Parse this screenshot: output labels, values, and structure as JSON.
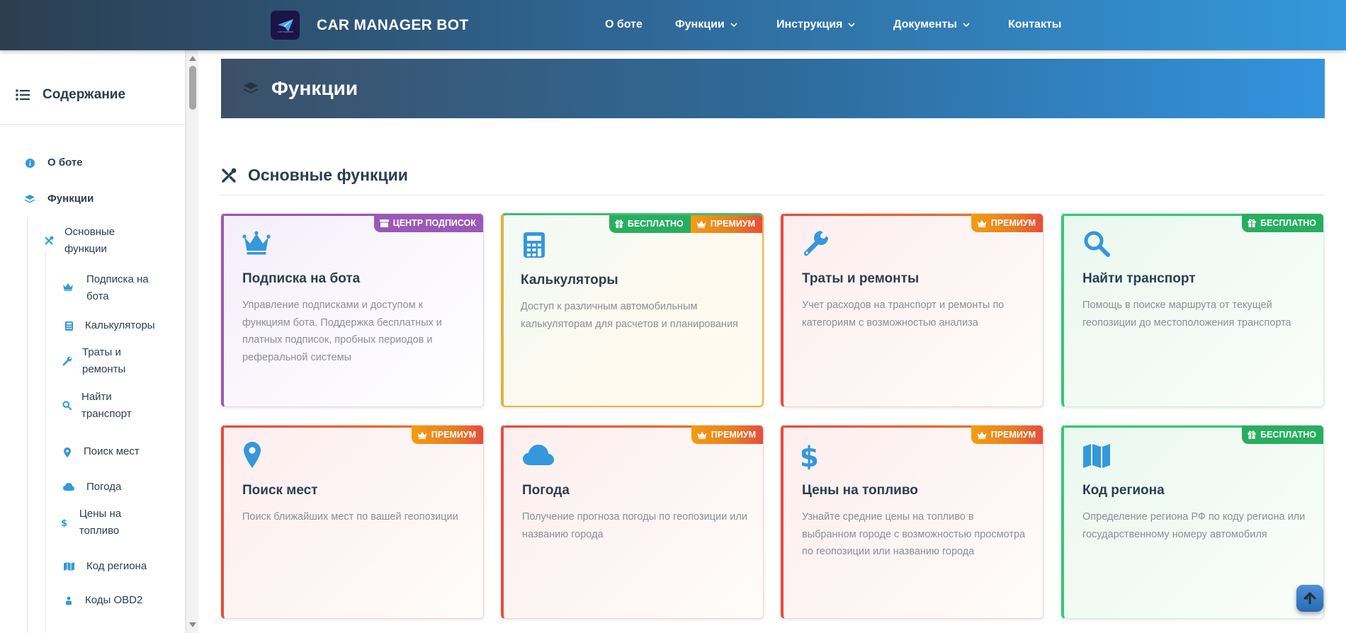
{
  "brand": {
    "title": "CAR MANAGER BOT",
    "logo_text": "CAR MANAGER"
  },
  "nav": {
    "about": "О боте",
    "functions": "Функции",
    "instructions": "Инструкция",
    "documents": "Документы",
    "contacts": "Контакты"
  },
  "sidebar": {
    "title": "Содержание",
    "items": [
      {
        "label": "О боте",
        "icon": "info-icon"
      },
      {
        "label": "Функции",
        "icon": "layers-icon"
      },
      {
        "label": "Основные функции",
        "icon": "tools-icon"
      },
      {
        "label": "Подписка на бота",
        "icon": "crown-icon"
      },
      {
        "label": "Калькуляторы",
        "icon": "calculator-icon"
      },
      {
        "label": "Траты и ремонты",
        "icon": "wrench-icon"
      },
      {
        "label": "Найти транспорт",
        "icon": "search-icon"
      },
      {
        "label": "Поиск мест",
        "icon": "map-pin-icon"
      },
      {
        "label": "Погода",
        "icon": "cloud-icon"
      },
      {
        "label": "Цены на топливо",
        "icon": "dollar-icon"
      },
      {
        "label": "Код региона",
        "icon": "map-icon"
      },
      {
        "label": "Коды OBD2",
        "icon": "obd-icon"
      }
    ]
  },
  "page": {
    "title": "Функции"
  },
  "section": {
    "title": "Основные функции"
  },
  "badges": {
    "subscriptions": "ЦЕНТР ПОДПИСОК",
    "free": "БЕСПЛАТНО",
    "premium": "ПРЕМИУМ"
  },
  "cards": [
    {
      "title": "Подписка на бота",
      "desc": "Управление подписками и доступом к функциям бота. Поддержка бесплатных и платных подписок, пробных периодов и реферальной системы",
      "icon": "crown-icon"
    },
    {
      "title": "Калькуляторы",
      "desc": "Доступ к различным автомобильным калькуляторам для расчетов и планирования",
      "icon": "calculator-icon"
    },
    {
      "title": "Траты и ремонты",
      "desc": "Учет расходов на транспорт и ремонты по категориям с возможностью анализа",
      "icon": "wrench-icon"
    },
    {
      "title": "Найти транспорт",
      "desc": "Помощь в поиске маршрута от текущей геопозиции до местоположения транспорта",
      "icon": "search-icon"
    },
    {
      "title": "Поиск мест",
      "desc": "Поиск ближайших мест по вашей геопозиции",
      "icon": "map-pin-icon"
    },
    {
      "title": "Погода",
      "desc": "Получение прогноза погоды по геопозиции или названию города",
      "icon": "cloud-icon"
    },
    {
      "title": "Цены на топливо",
      "desc": "Узнайте средние цены на топливо в выбранном городе с возможностью просмотра по геопозиции или названию города",
      "icon": "dollar-icon"
    },
    {
      "title": "Код региона",
      "desc": "Определение региона РФ по коду региона или государственному номеру автомобиля",
      "icon": "map-icon"
    }
  ],
  "colors": {
    "accent": "#3498db",
    "dark": "#2c3e50",
    "premium": "#e67e22",
    "free": "#27ae60",
    "subscription": "#9b59b6"
  }
}
